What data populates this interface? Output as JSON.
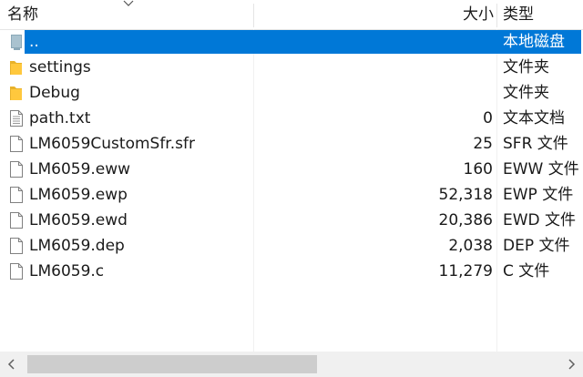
{
  "header": {
    "name_label": "名称",
    "size_label": "大小",
    "type_label": "类型"
  },
  "rows": [
    {
      "icon": "drive-icon",
      "name": "..",
      "size": "",
      "type": "本地磁盘",
      "selected": true
    },
    {
      "icon": "folder-icon",
      "name": "settings",
      "size": "",
      "type": "文件夹"
    },
    {
      "icon": "folder-icon",
      "name": "Debug",
      "size": "",
      "type": "文件夹"
    },
    {
      "icon": "text-file-icon",
      "name": "path.txt",
      "size": "0",
      "type": "文本文档"
    },
    {
      "icon": "file-icon",
      "name": "LM6059CustomSfr.sfr",
      "size": "25",
      "type": "SFR 文件"
    },
    {
      "icon": "file-icon",
      "name": "LM6059.eww",
      "size": "160",
      "type": "EWW 文件"
    },
    {
      "icon": "file-icon",
      "name": "LM6059.ewp",
      "size": "52,318",
      "type": "EWP 文件"
    },
    {
      "icon": "file-icon",
      "name": "LM6059.ewd",
      "size": "20,386",
      "type": "EWD 文件"
    },
    {
      "icon": "file-icon",
      "name": "LM6059.dep",
      "size": "2,038",
      "type": "DEP 文件"
    },
    {
      "icon": "file-icon",
      "name": "LM6059.c",
      "size": "11,279",
      "type": "C 文件"
    }
  ],
  "scrollbar": {
    "left_arrow_icon": "chevron-left-icon",
    "right_arrow_icon": "chevron-right-icon",
    "thumb_position": 0,
    "thumb_fraction": 0.54
  },
  "colors": {
    "selection": "#0078d7",
    "folder": "#ffc83d",
    "scrollbar_track": "#f0f0f0",
    "scrollbar_thumb": "#cdcdcd"
  }
}
